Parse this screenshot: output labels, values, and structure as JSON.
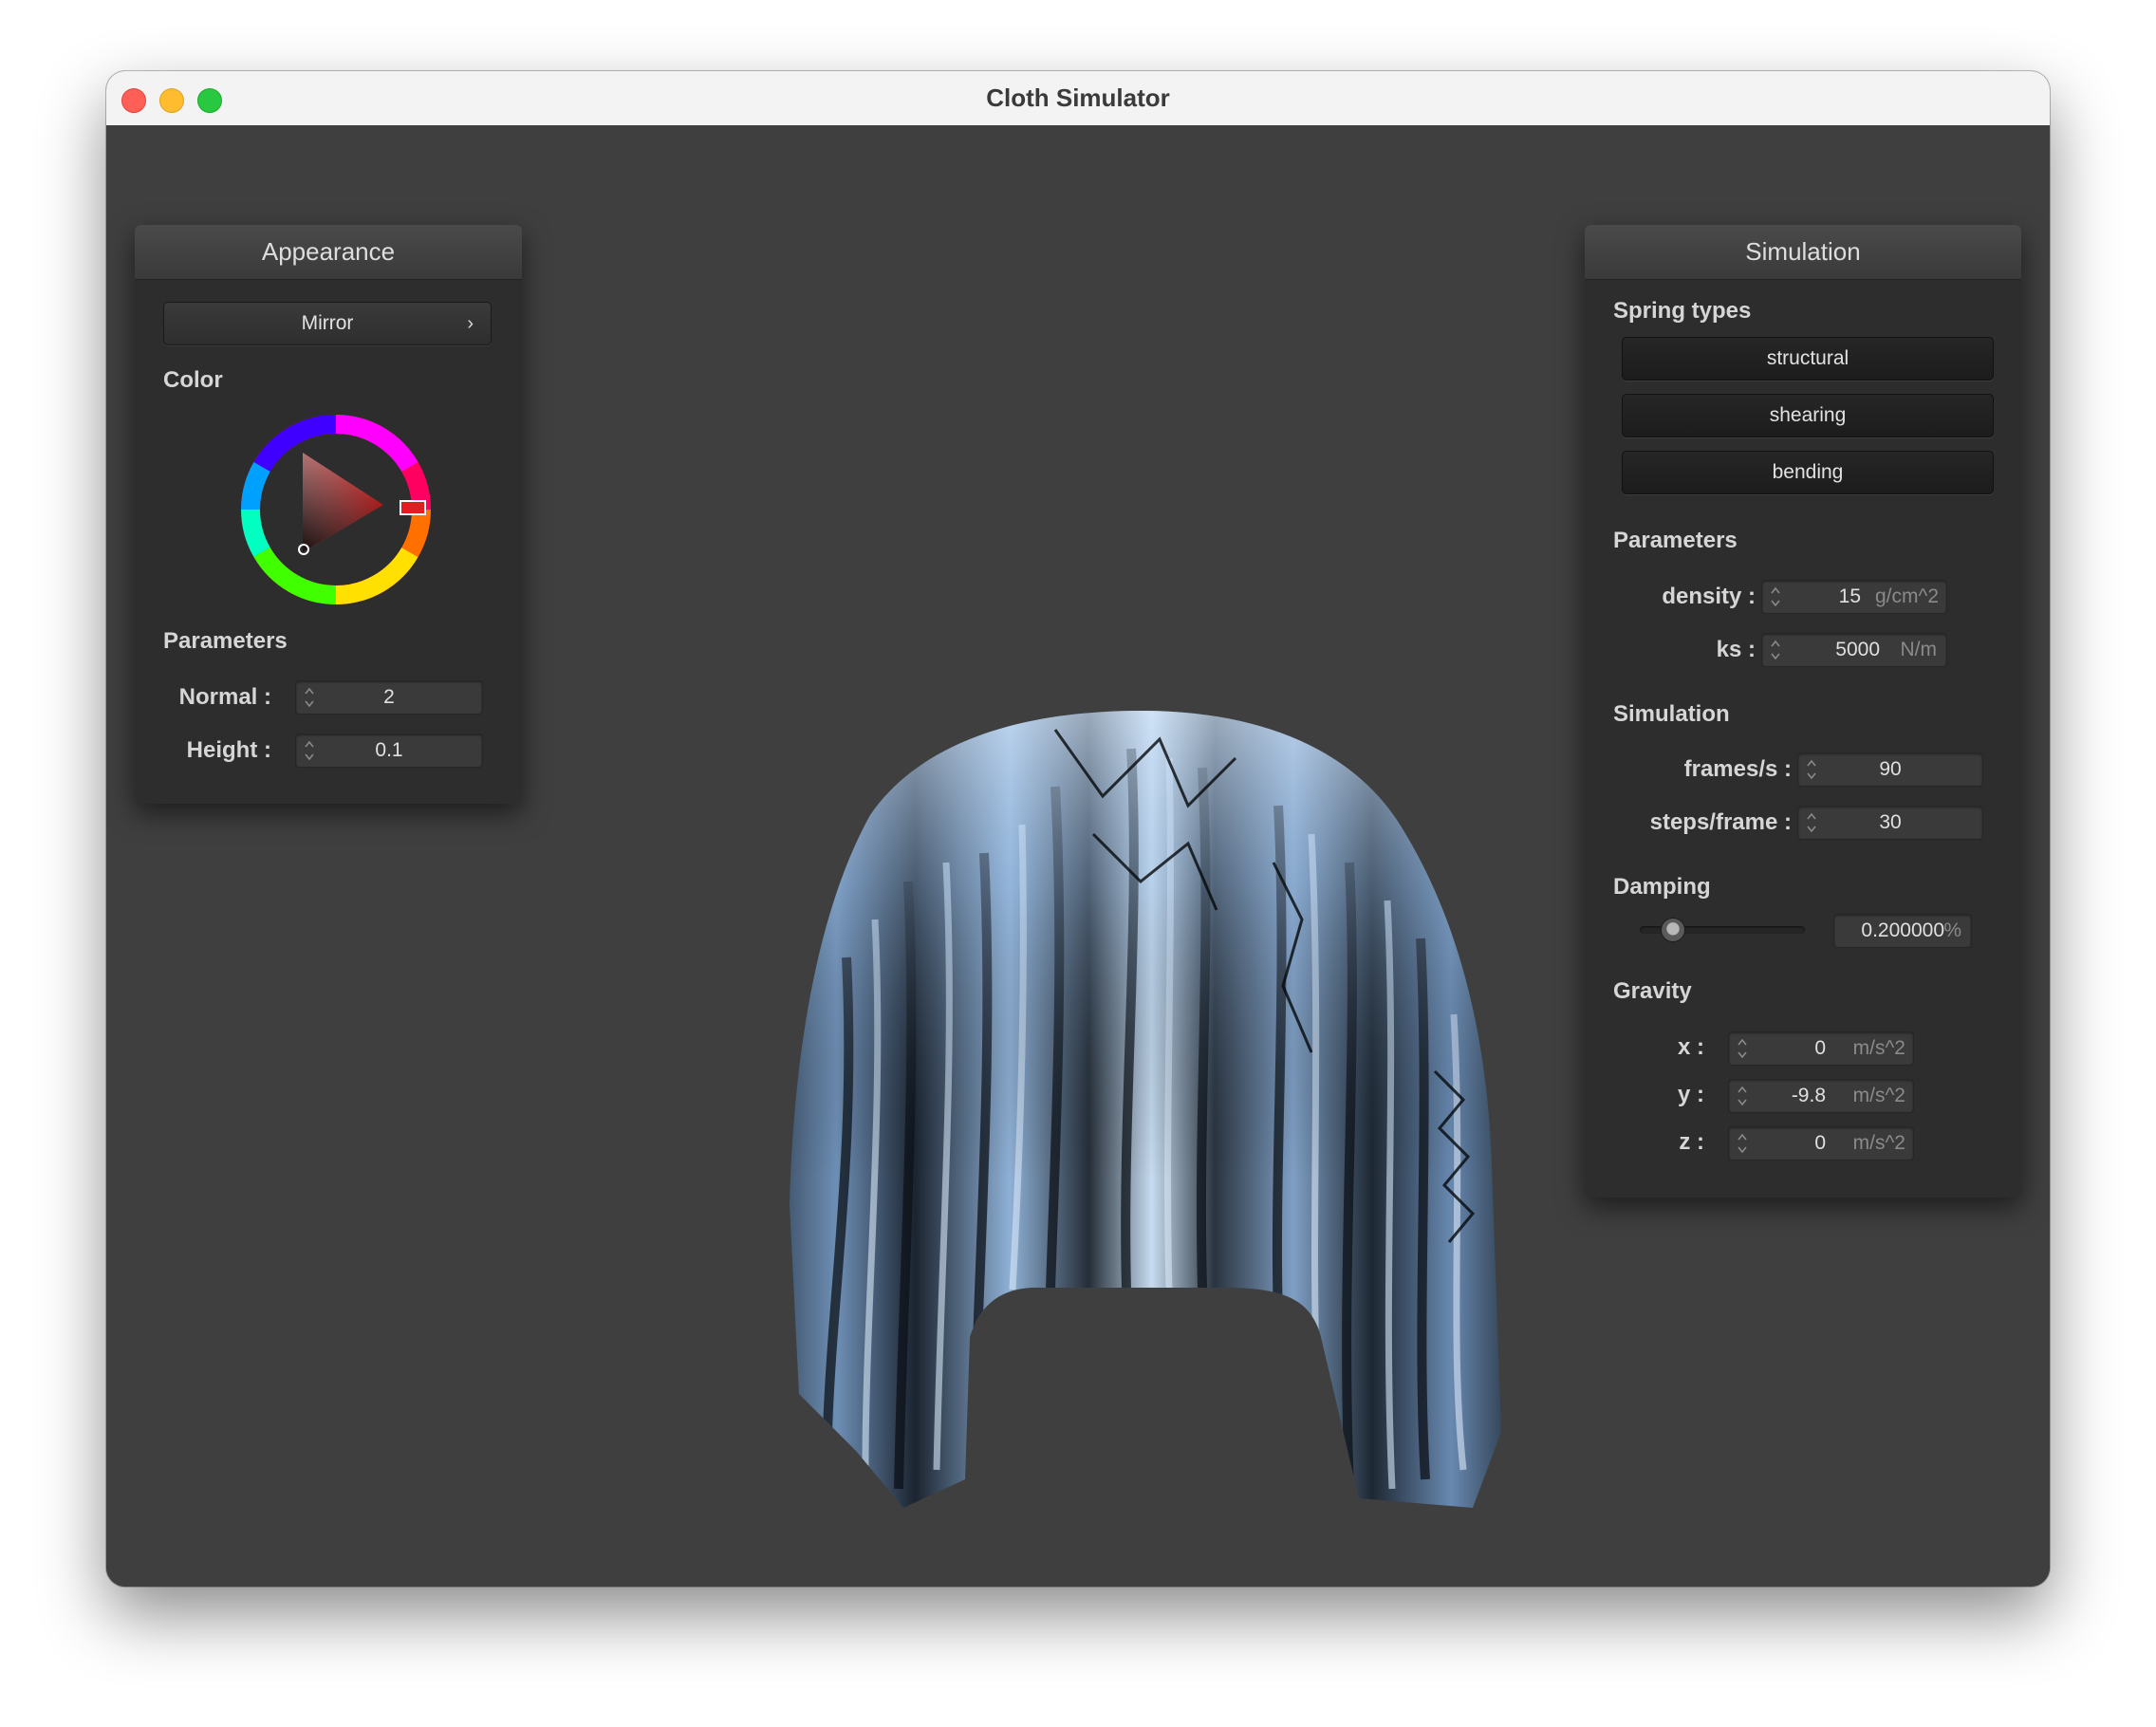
{
  "window": {
    "title": "Cloth Simulator"
  },
  "appearance": {
    "header": "Appearance",
    "material_button": "Mirror",
    "color_label": "Color",
    "parameters_label": "Parameters",
    "normal": {
      "label": "Normal :",
      "value": "2"
    },
    "height": {
      "label": "Height :",
      "value": "0.1"
    },
    "selected_color": "#e02020"
  },
  "simulation": {
    "header": "Simulation",
    "spring_types_label": "Spring types",
    "spring_types": [
      "structural",
      "shearing",
      "bending"
    ],
    "parameters_label": "Parameters",
    "density": {
      "label": "density :",
      "value": "15",
      "unit": "g/cm^2"
    },
    "ks": {
      "label": "ks :",
      "value": "5000",
      "unit": "N/m"
    },
    "simulation_label": "Simulation",
    "frames_per_s": {
      "label": "frames/s :",
      "value": "90"
    },
    "steps_per_frame": {
      "label": "steps/frame :",
      "value": "30"
    },
    "damping_label": "Damping",
    "damping": {
      "value": "0.200000",
      "unit": "%",
      "slider_fraction": 0.2
    },
    "gravity_label": "Gravity",
    "gravity": {
      "x": {
        "label": "x :",
        "value": "0",
        "unit": "m/s^2"
      },
      "y": {
        "label": "y :",
        "value": "-9.8",
        "unit": "m/s^2"
      },
      "z": {
        "label": "z :",
        "value": "0",
        "unit": "m/s^2"
      }
    }
  },
  "icons": {
    "chevron": "chevron-right-icon",
    "spinner": "stepper-arrows-icon"
  }
}
